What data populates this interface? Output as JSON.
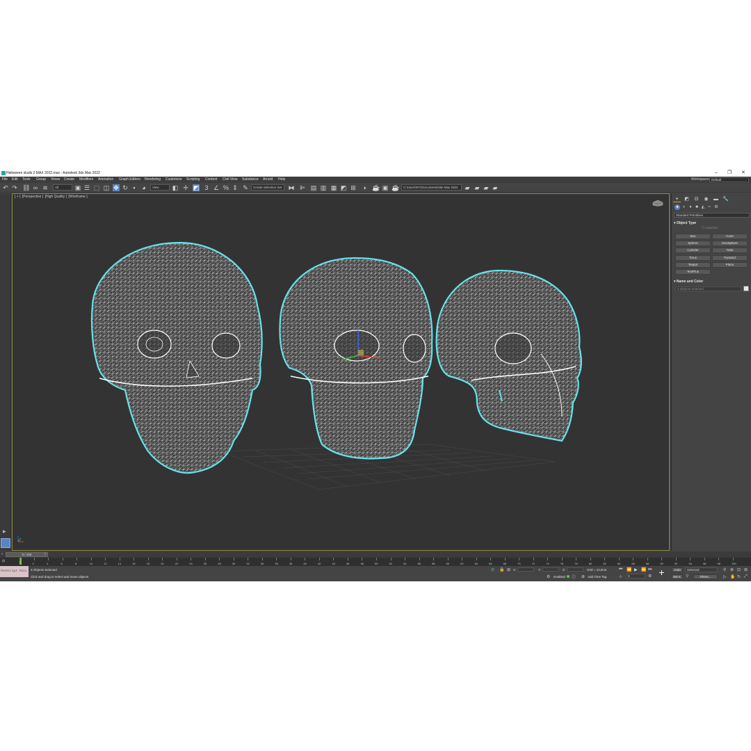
{
  "window": {
    "title": "Halloween skulls 2 MAX 2022.max - Autodesk 3ds Max 2022",
    "minimize": "–",
    "maximize": "❐",
    "close": "✕"
  },
  "menu": {
    "items": [
      "File",
      "Edit",
      "Tools",
      "Group",
      "Views",
      "Create",
      "Modifiers",
      "Animation",
      "Graph Editors",
      "Rendering",
      "Customize",
      "Scripting",
      "Content",
      "Civil View",
      "Substance",
      "Arnold",
      "Help"
    ],
    "workspaces_label": "Workspaces:",
    "workspace_value": "Default"
  },
  "toolbar": {
    "filter_value": "All",
    "refcoord_value": "View",
    "selection_set_value": "Create Selection Set",
    "project_path": "C:\\Users\\PC\\Documents\\3ds Max 2022"
  },
  "viewport": {
    "label_plus": "[ + ]",
    "label_view": "[Perspective ]",
    "label_quality": "[High Quality ]",
    "label_shading": "[Wireframe ]",
    "accent_color": "#8a8a40",
    "selection_outline_color": "#5fe0e8",
    "wire_color": "#ffffff"
  },
  "command_panel": {
    "category_value": "Standard Primitives",
    "object_type_header": "Object Type",
    "autogrid_label": "AutoGrid",
    "buttons": [
      "Box",
      "Cone",
      "Sphere",
      "GeoSphere",
      "Cylinder",
      "Tube",
      "Torus",
      "Pyramid",
      "Teapot",
      "Plane",
      "TextPlus"
    ],
    "name_color_header": "Name and Color",
    "name_value": "3 Objects Selected"
  },
  "timeline": {
    "slider_text": "0 / 100",
    "ticks": [
      "0",
      "2",
      "4",
      "6",
      "8",
      "10",
      "12",
      "14",
      "16",
      "18",
      "20",
      "22",
      "24",
      "26",
      "28",
      "30",
      "32",
      "34",
      "36",
      "38",
      "40",
      "42",
      "44",
      "46",
      "48",
      "50",
      "52",
      "54",
      "56",
      "58",
      "60",
      "62",
      "64",
      "66",
      "68",
      "70",
      "72",
      "74",
      "76",
      "78",
      "80",
      "82",
      "84",
      "86",
      "88",
      "90",
      "92",
      "94",
      "96",
      "98",
      "100"
    ]
  },
  "status": {
    "maxscript_label": "MAXScript Mini",
    "objects_selected": "3 Objects Selected",
    "prompt": "Click and drag to select and move objects",
    "x_label": "X:",
    "y_label": "Y:",
    "z_label": "Z:",
    "grid_text": "Grid = 10,0cm",
    "enabled_label": "Enabled:",
    "add_time_tag": "Add Time Tag",
    "auto_label": "Auto",
    "selected_value": "Selected",
    "setk_label": "Set K.",
    "filters_label": "Filters...",
    "frame_value": "0"
  }
}
